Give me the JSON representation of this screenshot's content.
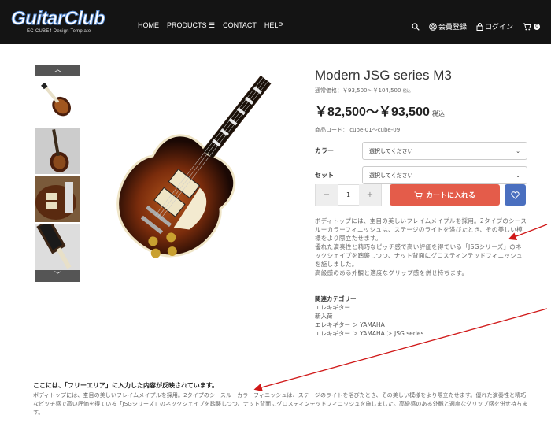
{
  "header": {
    "logo_main": "GuitarClub",
    "logo_sub": "EC-CUBE4 Design Template",
    "nav": [
      "HOME",
      "PRODUCTS ☰",
      "CONTACT",
      "HELP"
    ],
    "register": "会員登録",
    "login": "ログイン",
    "cart_count": "0"
  },
  "thumbs": {
    "up": "︿",
    "down": "﹀"
  },
  "product": {
    "title": "Modern JSG series M3",
    "regular_price": "通常価格：￥93,500～￥104,500",
    "regular_tax": "税込",
    "price": "￥82,500～￥93,500",
    "price_tax": "税込",
    "code": "商品コード： cube-01～cube-09",
    "color_label": "カラー",
    "color_value": "選択してください",
    "set_label": "セット",
    "set_value": "選択してください",
    "qty": "1",
    "cart_button": "カートに入れる",
    "description": "ボディトップには、杢目の美しいフレイムメイプルを採用。2タイプのシースルーカラーフィニッシュは、ステージのライトを浴びたとき、その美しい模様をより際立たせます。\n優れた演奏性と精巧なピッチ感で高い評価を得ている「JSGシリーズ」のネックシェイプを踏襲しつつ、ナット背面にグロスティンテッドフィニッシュを施しました。\n高級感のある外観と適度なグリップ感を併せ持ちます。",
    "related_title": "関連カテゴリー",
    "related": [
      "エレキギター",
      "新入荷",
      "エレキギター ＞ YAMAHA",
      "エレキギター ＞ YAMAHA ＞ JSG series"
    ]
  },
  "free_area": {
    "title": "ここには、「フリーエリア」に入力した内容が反映されています。",
    "text": "ボディトップには、杢目の美しいフレイムメイプルを採用。2タイプのシースルーカラーフィニッシュは、ステージのライトを浴びたとき、その美しい模様をより際立たせます。優れた演奏性と精巧なピッチ感で高い評価を得ている「JSGシリーズ」のネックシェイプを踏襲しつつ、ナット背面にグロスティンテッドフィニッシュを施しました。高級感のある外観と適度なグリップ感を併せ持ちます。"
  },
  "colors": {
    "header_bg": "#141414",
    "cart_button": "#e45c4a",
    "fav_button": "#4a6fbf",
    "annotation": "#d01818"
  }
}
